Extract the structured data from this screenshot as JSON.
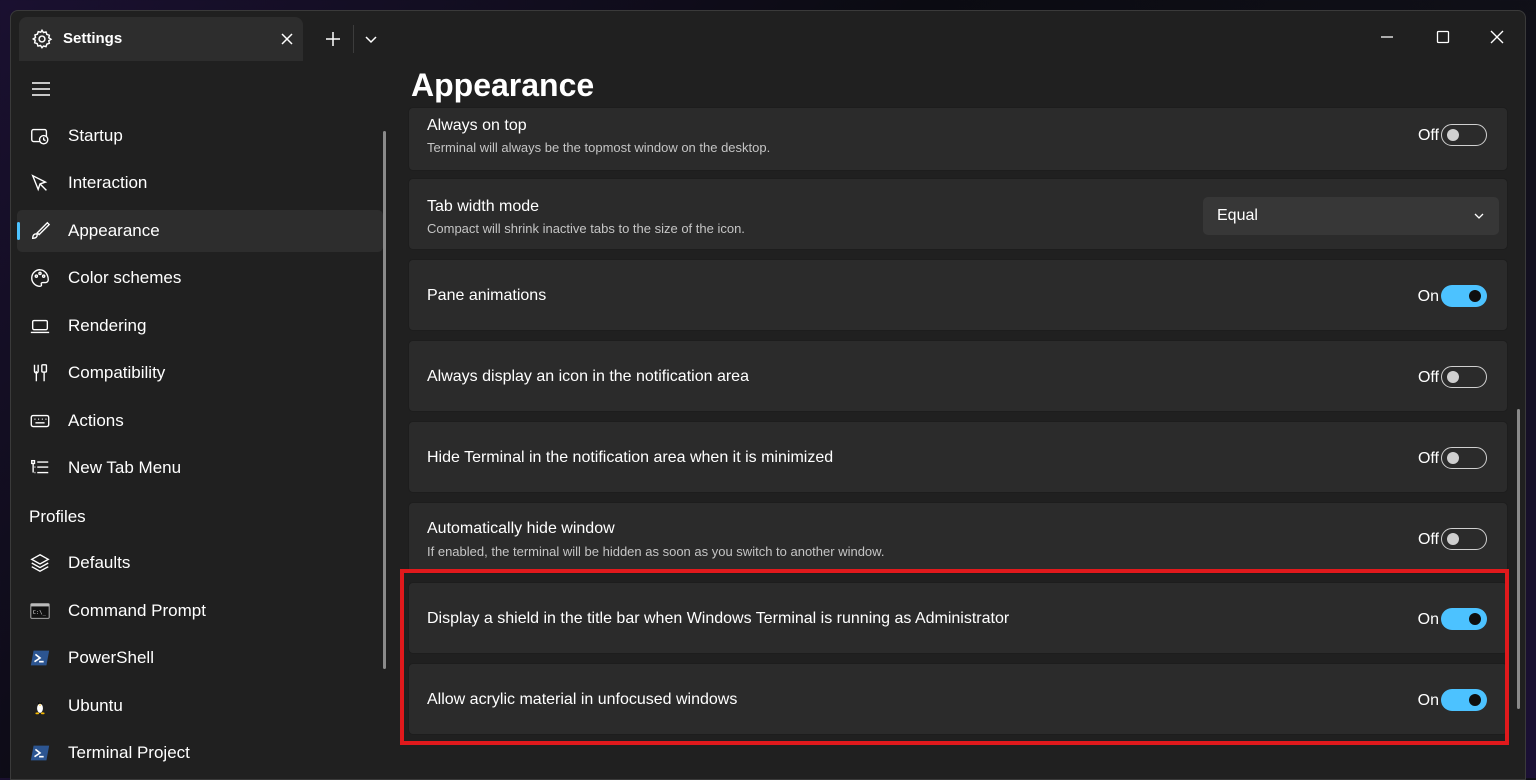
{
  "tab": {
    "title": "Settings",
    "icon": "gear-icon"
  },
  "titlebar": {
    "new_tab_icon": "plus-icon",
    "dropdown_icon": "chevron-down-icon",
    "minimize_icon": "minimize-icon",
    "maximize_icon": "maximize-icon",
    "close_icon": "close-icon"
  },
  "sidebar": {
    "items": [
      {
        "label": "Startup",
        "icon": "startup-icon",
        "selected": false
      },
      {
        "label": "Interaction",
        "icon": "pointer-icon",
        "selected": false
      },
      {
        "label": "Appearance",
        "icon": "brush-icon",
        "selected": true
      },
      {
        "label": "Color schemes",
        "icon": "palette-icon",
        "selected": false
      },
      {
        "label": "Rendering",
        "icon": "laptop-icon",
        "selected": false
      },
      {
        "label": "Compatibility",
        "icon": "tools-icon",
        "selected": false
      },
      {
        "label": "Actions",
        "icon": "keyboard-icon",
        "selected": false
      }
    ],
    "new_tab_menu": {
      "label": "New Tab Menu",
      "icon": "list-icon"
    },
    "profiles_header": "Profiles",
    "profiles": [
      {
        "label": "Defaults",
        "icon": "layers-icon"
      },
      {
        "label": "Command Prompt",
        "icon": "cmd-icon"
      },
      {
        "label": "PowerShell",
        "icon": "powershell-icon"
      },
      {
        "label": "Ubuntu",
        "icon": "linux-penguin-icon"
      },
      {
        "label": "Terminal Project",
        "icon": "powershell-icon"
      }
    ]
  },
  "page": {
    "title": "Appearance"
  },
  "settings": [
    {
      "title": "Always on top",
      "description": "Terminal will always be the topmost window on the desktop.",
      "state": "Off"
    },
    {
      "title": "Tab width mode",
      "description": "Compact will shrink inactive tabs to the size of the icon.",
      "value": "Equal"
    },
    {
      "title": "Pane animations",
      "state": "On"
    },
    {
      "title": "Always display an icon in the notification area",
      "state": "Off"
    },
    {
      "title": "Hide Terminal in the notification area when it is minimized",
      "state": "Off"
    },
    {
      "title": "Automatically hide window",
      "description": "If enabled, the terminal will be hidden as soon as you switch to another window.",
      "state": "Off"
    },
    {
      "title": "Display a shield in the title bar when Windows Terminal is running as Administrator",
      "state": "On"
    },
    {
      "title": "Allow acrylic material in unfocused windows",
      "state": "On"
    }
  ],
  "colors": {
    "accent": "#4cc2ff",
    "highlight": "#e0191c",
    "background": "#202020",
    "card": "#2b2b2b"
  }
}
